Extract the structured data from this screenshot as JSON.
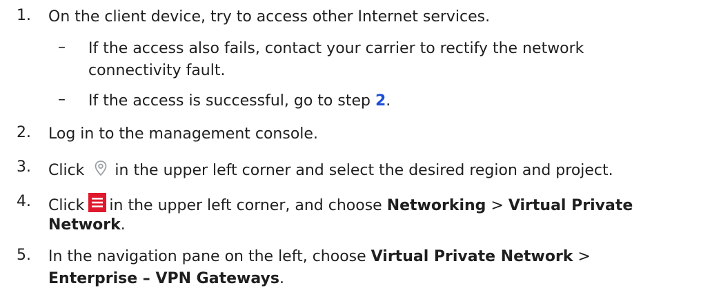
{
  "steps": [
    {
      "num": "1.",
      "text": "On the client device, try to access other Internet services."
    },
    {
      "num": "2.",
      "text": "Log in to the management console."
    },
    {
      "num": "3.",
      "pre": "Click",
      "post": "in the upper left corner and select the desired region and project."
    },
    {
      "num": "4.",
      "pre": "Click",
      "mid": "in the upper left corner, and choose",
      "b1": "Networking",
      "sep": ">",
      "b2": "Virtual Private",
      "b2cont": "Network",
      "end": "."
    },
    {
      "num": "5.",
      "text": "In the navigation pane on the left, choose",
      "b1": "Virtual Private Network",
      "sep": ">",
      "b2": "Enterprise – VPN Gateways",
      "end": "."
    }
  ],
  "substeps": [
    {
      "dash": "–",
      "line1": "If the access also fails, contact your carrier to rectify the network",
      "line2": "connectivity fault."
    },
    {
      "dash": "–",
      "text": "If the access is successful, go to step",
      "link": "2",
      "end": "."
    }
  ],
  "icons": {
    "location": "location-pin-icon",
    "menu": "hamburger-menu-icon",
    "menu_color": "#e0182d"
  },
  "colors": {
    "link": "#1a4fd6",
    "text": "#1f1f1f"
  }
}
